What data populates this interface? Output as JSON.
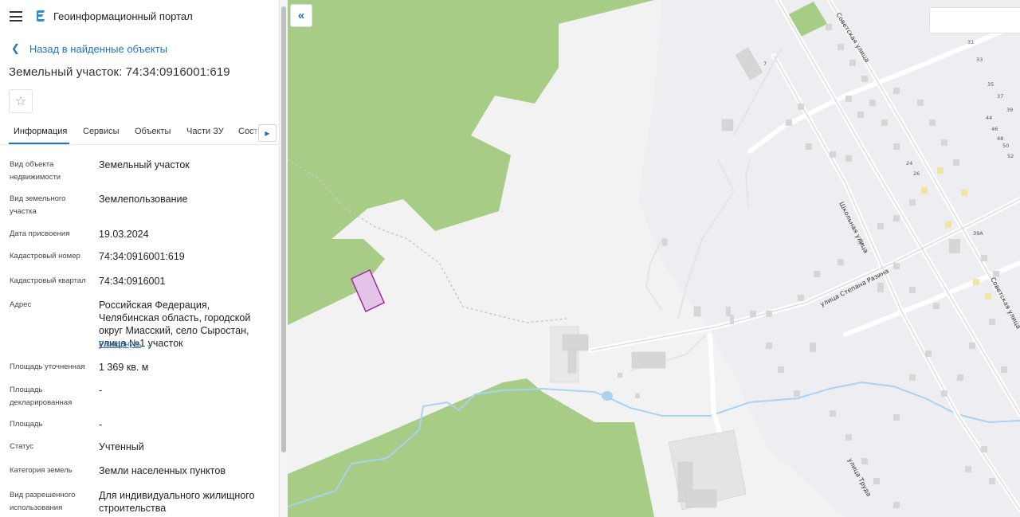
{
  "app": {
    "title": "Геоинформационный портал"
  },
  "nav": {
    "back_label": "Назад в найденные объекты"
  },
  "page": {
    "title": "Земельный участок: 74:34:0916001:619"
  },
  "tabs": [
    "Информация",
    "Сервисы",
    "Объекты",
    "Части ЗУ",
    "Соста"
  ],
  "attributes": [
    {
      "label": "Вид объекта недвижимости",
      "value": "Земельный участок"
    },
    {
      "label": "Вид земельного участка",
      "value": "Землепользование"
    },
    {
      "label": "Дата присвоения",
      "value": "19.03.2024"
    },
    {
      "label": "Кадастровый номер",
      "value": "74:34:0916001:619"
    },
    {
      "label": "Кадастровый квартал",
      "value": "74:34:0916001"
    },
    {
      "label": "Адрес",
      "value": "Российская Федерация, Челябинская область, городской округ Миасский, село Сыростан, улица №1 участок"
    },
    {
      "label": "Площадь уточненная",
      "value": "1 369 кв. м"
    },
    {
      "label": "Площадь декларированная",
      "value": "-"
    },
    {
      "label": "Площадь",
      "value": "-"
    },
    {
      "label": "Статус",
      "value": "Учтенный"
    },
    {
      "label": "Категория земель",
      "value": "Земли населенных пунктов"
    },
    {
      "label": "Вид разрешенного использования",
      "value": "Для индивидуального жилищного строительства"
    }
  ],
  "expand_label": "Развернуть",
  "map": {
    "colors": {
      "background": "#f2f2f2",
      "forest": "#a6cc86",
      "building": "#d6d6d6",
      "water": "#a9d2f3",
      "parcel": "#e3c4e8",
      "parcel_border": "#a5289b",
      "accent": "#1f73c4"
    },
    "street_labels": [
      "Советская улица",
      "Школьная улица",
      "улица Степана Разина",
      "Советская улица",
      "улица Труда"
    ],
    "house_numbers": [
      "7",
      "31",
      "33",
      "35",
      "37",
      "39",
      "44",
      "46",
      "48",
      "50",
      "52",
      "24",
      "26",
      "39А"
    ],
    "icons": [
      "menu-icon",
      "portal-logo-icon",
      "chevron-left-icon",
      "star-icon",
      "chevron-right-icon",
      "chevron-down-icon",
      "double-chevron-left-icon"
    ]
  }
}
